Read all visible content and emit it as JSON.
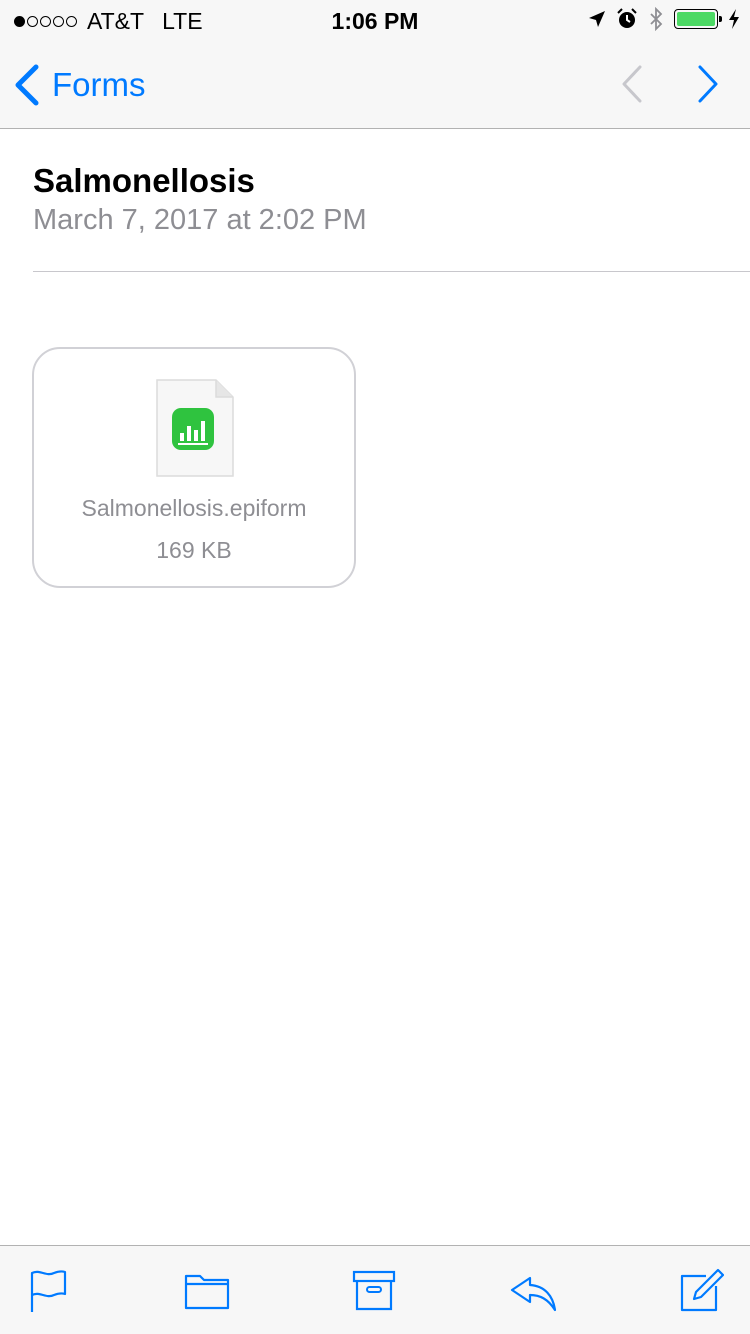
{
  "status_bar": {
    "carrier": "AT&T",
    "network": "LTE",
    "time": "1:06 PM",
    "battery_level": 1.0
  },
  "nav": {
    "back_label": "Forms"
  },
  "message": {
    "subject": "Salmonellosis",
    "date": "March 7, 2017 at 2:02 PM"
  },
  "attachment": {
    "filename": "Salmonellosis.epiform",
    "size": "169 KB",
    "icon": "numbers-app-icon"
  },
  "toolbar": {
    "items": [
      "flag-icon",
      "folder-icon",
      "archive-icon",
      "reply-icon",
      "compose-icon"
    ]
  },
  "colors": {
    "accent": "#007aff",
    "secondary_text": "#8e8e93",
    "battery": "#4cd964",
    "numbers_green": "#2fc33f"
  }
}
